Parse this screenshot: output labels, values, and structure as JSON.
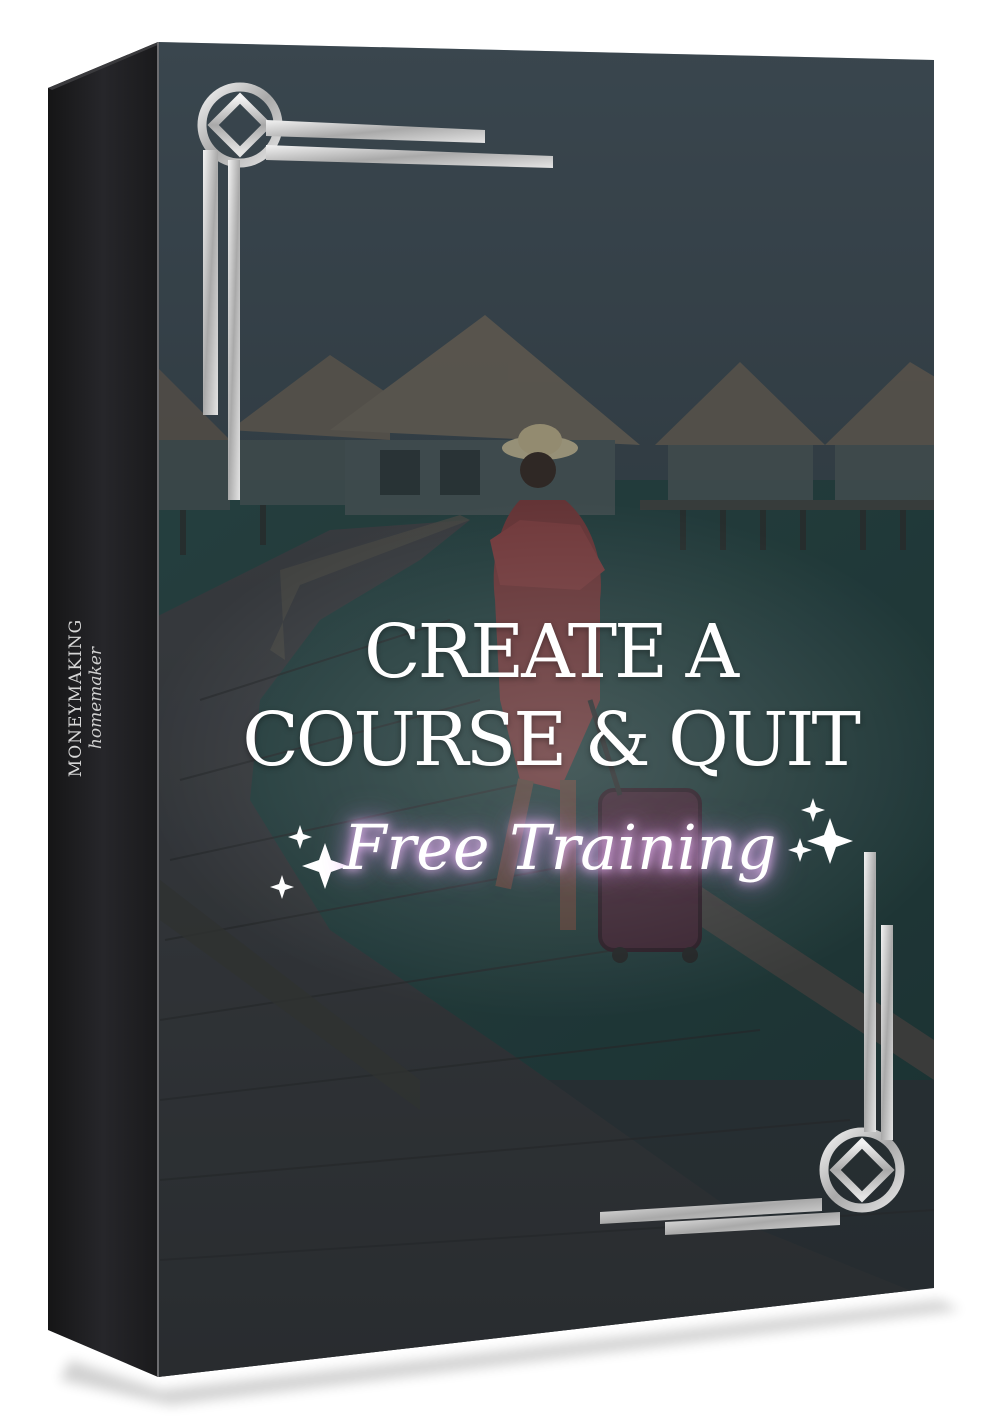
{
  "spine": {
    "line1": "MONEYMAKING",
    "line2": "homemaker"
  },
  "cover": {
    "title_line1": "CREATE A",
    "title_line2": "COURSE & QUIT",
    "subtitle": "Free Training"
  },
  "colors": {
    "spine": "#1f1f21",
    "frame": "#c9c9c9",
    "glow": "#e7a9ff",
    "sky": "#3d4a54",
    "water": "#1f4a48",
    "deck": "#3b3b3e"
  },
  "icons": [
    "sparkle-icon",
    "corner-emblem-icon"
  ]
}
